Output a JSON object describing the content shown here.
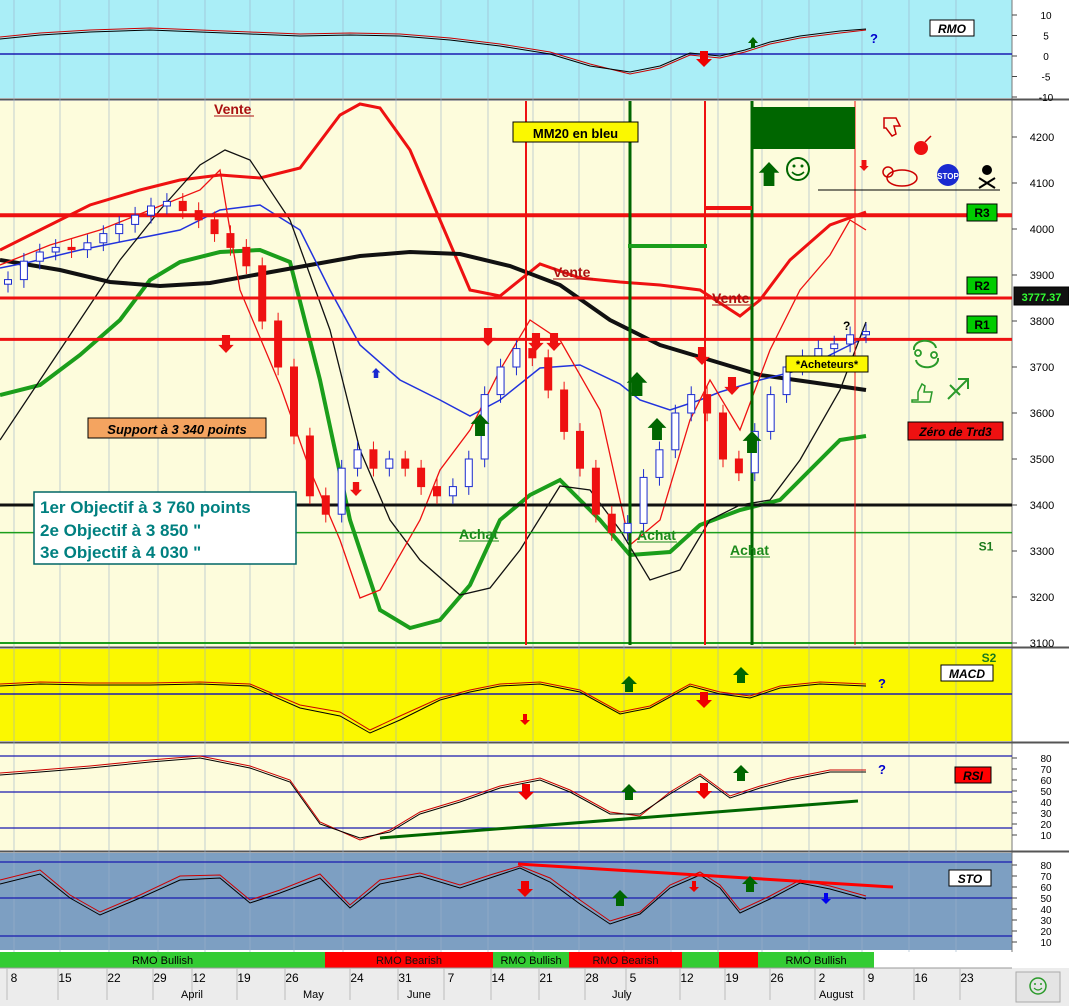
{
  "colors": {
    "rmo_bg": "#aaeef7",
    "main_bg": "#fdfcdc",
    "macd_bg": "#fbf800",
    "rsi_bg": "#fdfcdc",
    "sto_bg": "#7d9fc2",
    "bull": "#33cc33",
    "bear": "#ff0000",
    "axis_bg": "#c8e8c8"
  },
  "labels": {
    "mm20": "MM20 en bleu",
    "support": "Support à 3 340 points",
    "obj1": "1er  Objectif  à 3 760  points",
    "obj2": "2e   Objectif  à 3 850     \"",
    "obj3": "3e   Objectif  à 4 030     \"",
    "vente1": "Vente",
    "vente2": "Vente",
    "vente3": "Vente",
    "achat1": "Achat",
    "achat2": "Achat",
    "achat3": "Achat",
    "acheteurs": "*Acheteurs*",
    "zero_trd3": "Zéro de Trd3",
    "r3": "R3",
    "r2": "R2",
    "r1": "R1",
    "s1": "S1",
    "s2": "S2",
    "last_price": "3777.37",
    "stop": "STOP",
    "question": "?"
  },
  "chart_data": {
    "type": "candlestick",
    "panels": [
      {
        "name": "RMO",
        "ticks": [
          "10",
          "5",
          "0",
          "-5",
          "-10"
        ]
      },
      {
        "name": "main",
        "ticks": [
          "4200",
          "4100",
          "4000",
          "3900",
          "3800",
          "3700",
          "3600",
          "3500",
          "3400",
          "3300",
          "3200",
          "3100"
        ],
        "ylim": [
          3020,
          4240
        ]
      },
      {
        "name": "MACD",
        "ticks": []
      },
      {
        "name": "RSI",
        "ticks": [
          "80",
          "70",
          "60",
          "50",
          "40",
          "30",
          "20",
          "10"
        ],
        "ylim": [
          0,
          90
        ]
      },
      {
        "name": "STO",
        "ticks": [
          "80",
          "70",
          "60",
          "50",
          "40",
          "30",
          "20",
          "10"
        ],
        "ylim": [
          0,
          90
        ]
      }
    ],
    "levels": {
      "R3": 4030,
      "R2": 3850,
      "R1": 3760,
      "S1": 3340,
      "S2": 3100,
      "support": 3400
    },
    "x_ticks": [
      "8",
      "15",
      "22",
      "29",
      "12",
      "19",
      "26",
      "24",
      "31",
      "7",
      "14",
      "21",
      "28",
      "5",
      "12",
      "19",
      "26",
      "2",
      "9",
      "16",
      "23"
    ],
    "months": [
      "April",
      "May",
      "June",
      "July",
      "August"
    ],
    "rmo_bands": [
      {
        "label": "RMO Bullish",
        "state": "bull"
      },
      {
        "label": "RMO Bearish",
        "state": "bear"
      },
      {
        "label": "RMO Bullish",
        "state": "bull"
      },
      {
        "label": "RMO Bearish",
        "state": "bear"
      },
      {
        "label": "",
        "state": "bull"
      },
      {
        "label": "",
        "state": "bear"
      },
      {
        "label": "RMO Bullish",
        "state": "bull"
      }
    ],
    "close_series": [
      3890,
      3930,
      3950,
      3960,
      3955,
      3970,
      3990,
      4010,
      4030,
      4050,
      4060,
      4040,
      4020,
      3990,
      3960,
      3920,
      3800,
      3700,
      3550,
      3420,
      3380,
      3480,
      3520,
      3480,
      3500,
      3480,
      3440,
      3420,
      3440,
      3500,
      3640,
      3700,
      3740,
      3720,
      3650,
      3560,
      3480,
      3380,
      3340,
      3360,
      3460,
      3520,
      3600,
      3640,
      3600,
      3500,
      3470,
      3560,
      3640,
      3700,
      3720,
      3740,
      3750,
      3770,
      3777
    ],
    "mm20_series": [
      3790,
      3810,
      3830,
      3850,
      3870,
      3890,
      3910,
      3930,
      3950,
      3960,
      3970,
      3980,
      3980,
      3975,
      3960,
      3930,
      3880,
      3820,
      3750,
      3680,
      3620,
      3570,
      3530,
      3500,
      3490,
      3480,
      3480,
      3490,
      3500,
      3520,
      3550,
      3580,
      3600,
      3610,
      3600,
      3580,
      3550,
      3520,
      3490,
      3480,
      3480,
      3490,
      3510,
      3540,
      3560,
      3560,
      3560,
      3580,
      3600,
      3620,
      3640,
      3660,
      3680,
      3690,
      3700
    ]
  }
}
